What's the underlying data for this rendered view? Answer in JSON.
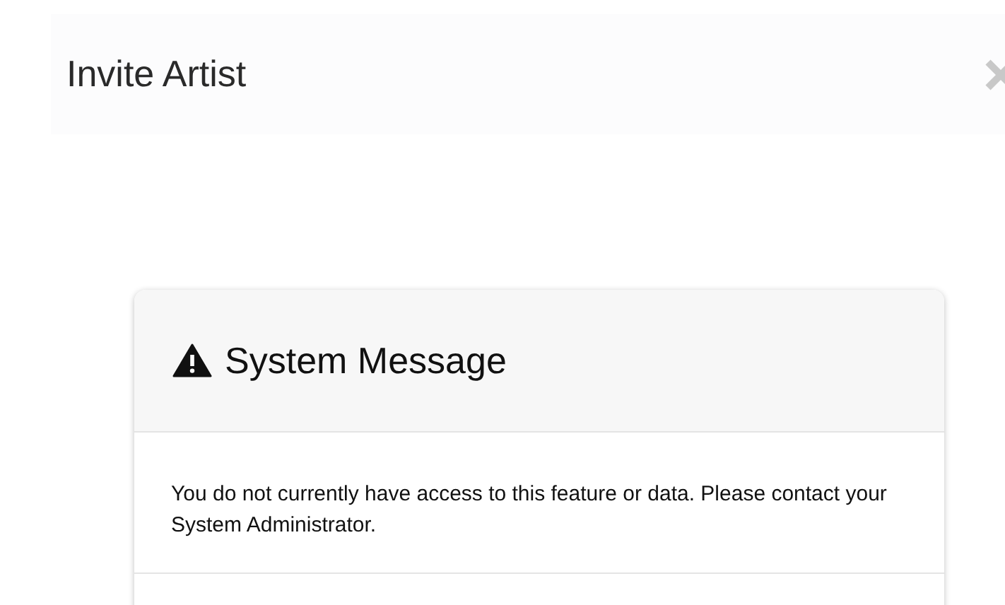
{
  "page": {
    "title": "Invite Artist"
  },
  "dialog": {
    "title": "System Message",
    "message": "You do not currently have access to this feature or data. Please contact your System Administrator."
  }
}
